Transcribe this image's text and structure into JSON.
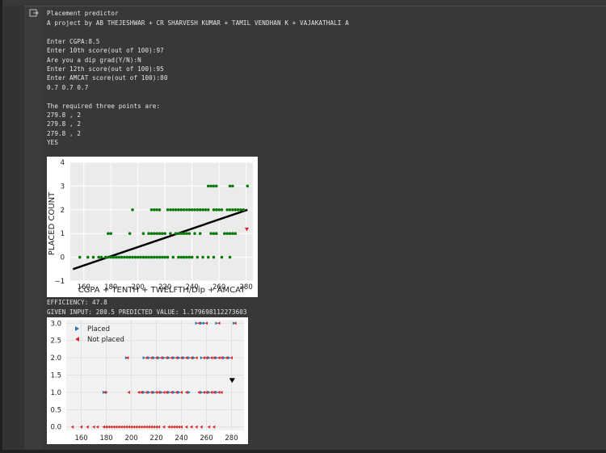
{
  "cell": {
    "run_icon": "run-output-icon"
  },
  "output": {
    "header": [
      "Placement predictor",
      "A project by AB THEJESHWAR + CR SHARVESH KUMAR + TAMIL VENDHAN K + VAJAKATHALI A"
    ],
    "inputs": [
      "Enter CGPA:8.5",
      "Enter 10th score(out of 100):97",
      "Are you a dip grad(Y/N):N",
      "Enter 12th score(out of 100):95",
      "Enter AMCAT score(out of 100):80",
      "0.7 0.7 0.7"
    ],
    "points_header": "The required three points are:",
    "points": [
      "279.8 , 2",
      "279.8 , 2",
      "279.8 , 2"
    ],
    "verdict": "YES",
    "efficiency": "EFFICIENCY: 47.8",
    "given": "GIVEN INPUT: 280.5 PREDICTED VALUE: 1.179698112273603"
  },
  "chart_data": [
    {
      "type": "scatter",
      "title": "",
      "xlabel": "CGPA + TENTH + TWELFTH/Dip + AMCAT",
      "ylabel": "PLACED COUNT",
      "xlim": [
        150,
        285
      ],
      "ylim": [
        -1,
        4
      ],
      "xticks": [
        160,
        180,
        200,
        220,
        240,
        260,
        280
      ],
      "yticks": [
        -1,
        0,
        1,
        2,
        3,
        4
      ],
      "grid": true,
      "series": [
        {
          "color": "#0a7a0a",
          "points": [
            [
              157,
              0
            ],
            [
              163,
              0
            ],
            [
              167,
              0
            ],
            [
              171,
              0
            ],
            [
              173,
              0
            ],
            [
              176,
              0
            ],
            [
              178,
              0
            ],
            [
              180,
              0
            ],
            [
              182,
              0
            ],
            [
              184,
              0
            ],
            [
              186,
              0
            ],
            [
              188,
              0
            ],
            [
              190,
              0
            ],
            [
              192,
              0
            ],
            [
              194,
              0
            ],
            [
              196,
              0
            ],
            [
              198,
              0
            ],
            [
              200,
              0
            ],
            [
              202,
              0
            ],
            [
              204,
              0
            ],
            [
              206,
              0
            ],
            [
              208,
              0
            ],
            [
              210,
              0
            ],
            [
              212,
              0
            ],
            [
              214,
              0
            ],
            [
              216,
              0
            ],
            [
              218,
              0
            ],
            [
              220,
              0
            ],
            [
              222,
              0
            ],
            [
              226,
              0
            ],
            [
              230,
              0
            ],
            [
              232,
              0
            ],
            [
              234,
              0
            ],
            [
              236,
              0
            ],
            [
              238,
              0
            ],
            [
              240,
              0
            ],
            [
              244,
              0
            ],
            [
              248,
              0
            ],
            [
              252,
              0
            ],
            [
              256,
              0
            ],
            [
              262,
              0
            ],
            [
              268,
              0
            ],
            [
              178,
              1
            ],
            [
              180,
              1
            ],
            [
              194,
              1
            ],
            [
              204,
              1
            ],
            [
              208,
              1
            ],
            [
              210,
              1
            ],
            [
              212,
              1
            ],
            [
              214,
              1
            ],
            [
              216,
              1
            ],
            [
              218,
              1
            ],
            [
              220,
              1
            ],
            [
              224,
              1
            ],
            [
              228,
              1
            ],
            [
              230,
              1
            ],
            [
              232,
              1
            ],
            [
              234,
              1
            ],
            [
              236,
              1
            ],
            [
              238,
              1
            ],
            [
              242,
              1
            ],
            [
              246,
              1
            ],
            [
              254,
              1
            ],
            [
              256,
              1
            ],
            [
              258,
              1
            ],
            [
              264,
              1
            ],
            [
              266,
              1
            ],
            [
              268,
              1
            ],
            [
              270,
              1
            ],
            [
              272,
              1
            ],
            [
              196,
              2
            ],
            [
              210,
              2
            ],
            [
              212,
              2
            ],
            [
              214,
              2
            ],
            [
              216,
              2
            ],
            [
              222,
              2
            ],
            [
              224,
              2
            ],
            [
              226,
              2
            ],
            [
              228,
              2
            ],
            [
              230,
              2
            ],
            [
              232,
              2
            ],
            [
              234,
              2
            ],
            [
              236,
              2
            ],
            [
              238,
              2
            ],
            [
              240,
              2
            ],
            [
              242,
              2
            ],
            [
              244,
              2
            ],
            [
              246,
              2
            ],
            [
              248,
              2
            ],
            [
              250,
              2
            ],
            [
              252,
              2
            ],
            [
              256,
              2
            ],
            [
              258,
              2
            ],
            [
              260,
              2
            ],
            [
              262,
              2
            ],
            [
              266,
              2
            ],
            [
              268,
              2
            ],
            [
              270,
              2
            ],
            [
              272,
              2
            ],
            [
              274,
              2
            ],
            [
              276,
              2
            ],
            [
              278,
              2
            ],
            [
              252,
              3
            ],
            [
              254,
              3
            ],
            [
              256,
              3
            ],
            [
              258,
              3
            ],
            [
              268,
              3
            ],
            [
              270,
              3
            ],
            [
              281,
              3
            ]
          ]
        },
        {
          "color": "#e02020",
          "points": [
            [
              280.5,
              1.18
            ]
          ]
        }
      ],
      "regression_line": {
        "color": "#000000",
        "x": [
          152,
          281
        ],
        "y": [
          -0.5,
          2.0
        ]
      }
    },
    {
      "type": "scatter",
      "title": "",
      "xlabel": "",
      "ylabel": "",
      "xlim": [
        148,
        290
      ],
      "ylim": [
        -0.1,
        3.1
      ],
      "xticks": [
        160,
        180,
        200,
        220,
        240,
        260,
        280
      ],
      "yticks": [
        0.0,
        0.5,
        1.0,
        1.5,
        2.0,
        2.5,
        3.0
      ],
      "grid": true,
      "legend": "top-left",
      "series": [
        {
          "name": "Placed",
          "color": "#1f77b4",
          "marker": "triangle-right",
          "points": [
            [
              178,
              1
            ],
            [
              180,
              1
            ],
            [
              196,
              2
            ],
            [
              210,
              2
            ],
            [
              214,
              2
            ],
            [
              218,
              2
            ],
            [
              222,
              2
            ],
            [
              226,
              2
            ],
            [
              230,
              2
            ],
            [
              234,
              2
            ],
            [
              238,
              2
            ],
            [
              242,
              2
            ],
            [
              246,
              2
            ],
            [
              250,
              2
            ],
            [
              256,
              2
            ],
            [
              262,
              2
            ],
            [
              268,
              2
            ],
            [
              274,
              2
            ],
            [
              278,
              2
            ],
            [
              210,
              1
            ],
            [
              214,
              1
            ],
            [
              218,
              1
            ],
            [
              224,
              1
            ],
            [
              230,
              1
            ],
            [
              234,
              1
            ],
            [
              238,
              1
            ],
            [
              246,
              1
            ],
            [
              256,
              1
            ],
            [
              262,
              1
            ],
            [
              268,
              1
            ],
            [
              252,
              3
            ],
            [
              256,
              3
            ],
            [
              258,
              3
            ],
            [
              268,
              3
            ],
            [
              282,
              3
            ]
          ]
        },
        {
          "name": "Not placed",
          "color": "#d62728",
          "marker": "triangle-left",
          "points": [
            [
              153,
              0
            ],
            [
              160,
              0
            ],
            [
              165,
              0
            ],
            [
              170,
              0
            ],
            [
              173,
              0
            ],
            [
              178,
              0
            ],
            [
              180,
              0
            ],
            [
              182,
              0
            ],
            [
              184,
              0
            ],
            [
              186,
              0
            ],
            [
              188,
              0
            ],
            [
              190,
              0
            ],
            [
              192,
              0
            ],
            [
              194,
              0
            ],
            [
              196,
              0
            ],
            [
              198,
              0
            ],
            [
              200,
              0
            ],
            [
              202,
              0
            ],
            [
              204,
              0
            ],
            [
              206,
              0
            ],
            [
              208,
              0
            ],
            [
              210,
              0
            ],
            [
              212,
              0
            ],
            [
              214,
              0
            ],
            [
              216,
              0
            ],
            [
              218,
              0
            ],
            [
              220,
              0
            ],
            [
              222,
              0
            ],
            [
              226,
              0
            ],
            [
              230,
              0
            ],
            [
              232,
              0
            ],
            [
              234,
              0
            ],
            [
              236,
              0
            ],
            [
              238,
              0
            ],
            [
              240,
              0
            ],
            [
              244,
              0
            ],
            [
              248,
              0
            ],
            [
              252,
              0
            ],
            [
              256,
              0
            ],
            [
              262,
              0
            ],
            [
              266,
              0
            ],
            [
              179,
              1
            ],
            [
              198,
              1
            ],
            [
              206,
              1
            ],
            [
              208,
              1
            ],
            [
              212,
              1
            ],
            [
              216,
              1
            ],
            [
              220,
              1
            ],
            [
              222,
              1
            ],
            [
              226,
              1
            ],
            [
              228,
              1
            ],
            [
              232,
              1
            ],
            [
              236,
              1
            ],
            [
              240,
              1
            ],
            [
              244,
              1
            ],
            [
              254,
              1
            ],
            [
              258,
              1
            ],
            [
              260,
              1
            ],
            [
              264,
              1
            ],
            [
              266,
              1
            ],
            [
              270,
              1
            ],
            [
              272,
              1
            ],
            [
              197,
              2
            ],
            [
              212,
              2
            ],
            [
              216,
              2
            ],
            [
              220,
              2
            ],
            [
              224,
              2
            ],
            [
              228,
              2
            ],
            [
              232,
              2
            ],
            [
              236,
              2
            ],
            [
              240,
              2
            ],
            [
              244,
              2
            ],
            [
              248,
              2
            ],
            [
              252,
              2
            ],
            [
              258,
              2
            ],
            [
              260,
              2
            ],
            [
              264,
              2
            ],
            [
              266,
              2
            ],
            [
              270,
              2
            ],
            [
              272,
              2
            ],
            [
              276,
              2
            ],
            [
              280,
              2
            ],
            [
              254,
              3
            ],
            [
              260,
              3
            ],
            [
              270,
              3
            ],
            [
              283,
              3
            ]
          ]
        },
        {
          "color": "#000000",
          "marker": "triangle-down",
          "points": [
            [
              280.5,
              1.18
            ]
          ]
        }
      ]
    }
  ]
}
